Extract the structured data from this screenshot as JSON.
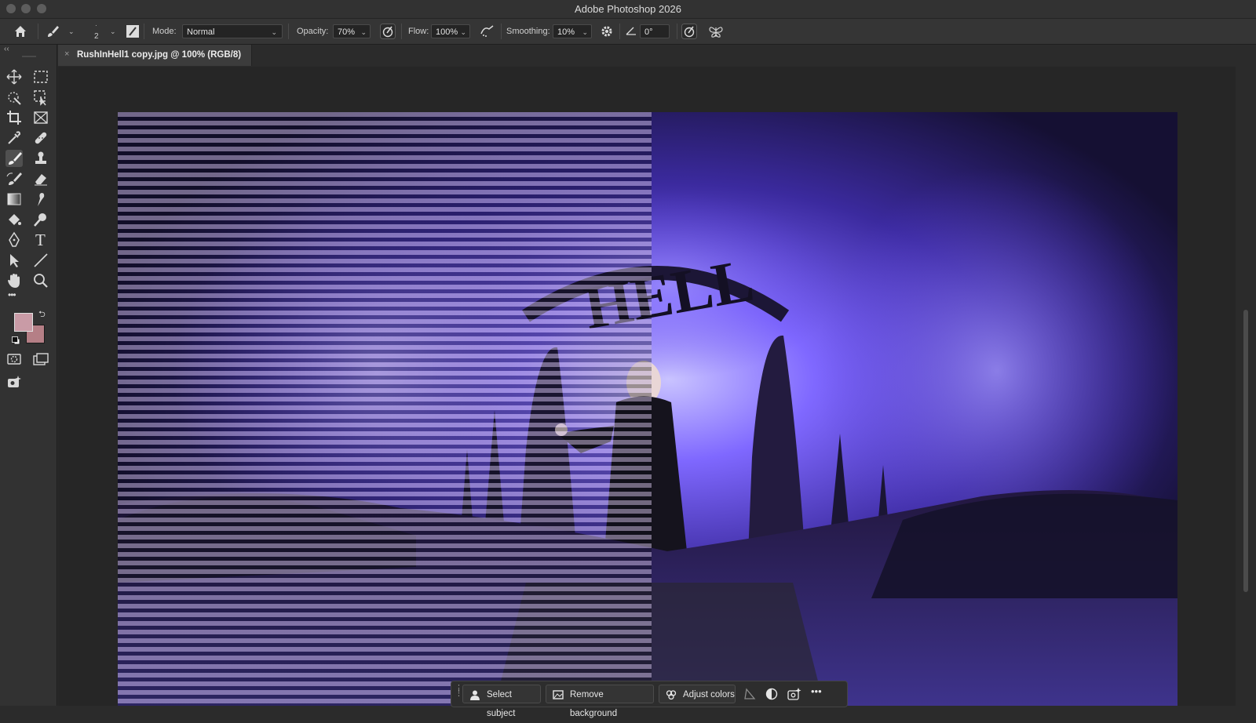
{
  "window": {
    "title": "Adobe Photoshop 2026"
  },
  "options_bar": {
    "brush_size": "2",
    "mode_label": "Mode:",
    "mode_value": "Normal",
    "opacity_label": "Opacity:",
    "opacity_value": "70%",
    "flow_label": "Flow:",
    "flow_value": "100%",
    "smoothing_label": "Smoothing:",
    "smoothing_value": "10%",
    "angle_value": "0°"
  },
  "document": {
    "tab_label": "RushInHell1 copy.jpg @ 100% (RGB/8)",
    "tab_close": "×"
  },
  "colors": {
    "foreground": "#c99ba6",
    "background": "#b57f86",
    "accent_flame": "#6a4cff",
    "panel_bg": "#323232"
  },
  "tools": [
    "move-icon",
    "marquee-icon",
    "quick-selection-icon",
    "object-selection-icon",
    "crop-icon",
    "frame-icon",
    "eyedropper-icon",
    "healing-brush-icon",
    "brush-icon",
    "clone-stamp-icon",
    "history-brush-icon",
    "eraser-icon",
    "gradient-icon",
    "smudge-icon",
    "paint-bucket-icon",
    "dodge-icon",
    "pen-icon",
    "type-icon",
    "path-selection-icon",
    "line-icon",
    "hand-icon",
    "zoom-icon",
    "more-tools-icon"
  ],
  "type_tool_glyph": "T",
  "more_tools_glyph": "•••",
  "contextual_taskbar": {
    "select_subject": "Select subject",
    "remove_background": "Remove background",
    "adjust_colors": "Adjust colors",
    "more": "•••"
  },
  "artwork": {
    "sign_text": "HELL"
  }
}
